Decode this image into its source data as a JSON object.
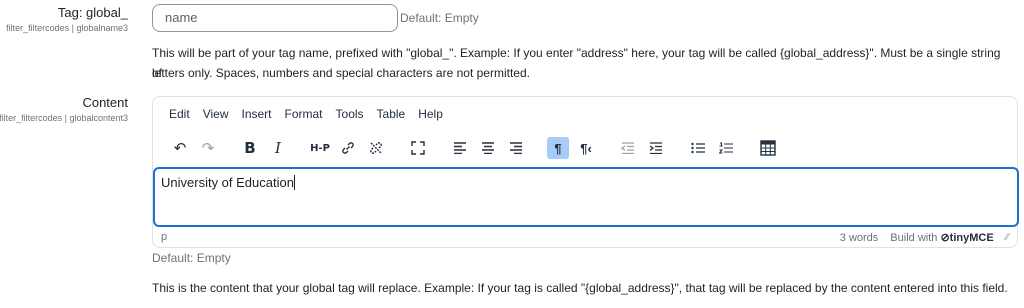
{
  "field_tag": {
    "label": "Tag: global_",
    "sublabel": "filter_filtercodes | globalname3",
    "input_value": "name",
    "default_note": "Default: Empty",
    "help_line1": "This will be part of your tag name, prefixed with \"global_\". Example: If you enter \"address\" here, your tag will be called {global_address}\". Must be a single string of",
    "help_line2": "letters only. Spaces, numbers and special characters are not permitted."
  },
  "field_content": {
    "label": "Content",
    "sublabel": "filter_filtercodes | globalcontent3",
    "default_note": "Default: Empty",
    "help": "This is the content that your global tag will replace. Example: If your tag is called \"{global_address}\", that tag will be replaced by the content entered into this field."
  },
  "editor": {
    "menu": [
      "Edit",
      "View",
      "Insert",
      "Format",
      "Tools",
      "Table",
      "Help"
    ],
    "toolbar_icons": [
      "undo-icon",
      "redo-icon",
      "bold-icon",
      "italic-icon",
      "h5p-icon",
      "link-icon",
      "unlink-icon",
      "fullscreen-icon",
      "align-left-icon",
      "align-center-icon",
      "align-right-icon",
      "ltr-icon",
      "rtl-icon",
      "outdent-icon",
      "indent-icon",
      "bullet-list-icon",
      "numbered-list-icon",
      "table-icon"
    ],
    "h5p_label": "H-P",
    "bold_label": "B",
    "italic_label": "I",
    "content_text": "University of Education",
    "status_path": "p",
    "word_count": "3 words",
    "build_with": "Build with",
    "brand": "tinyMCE"
  }
}
